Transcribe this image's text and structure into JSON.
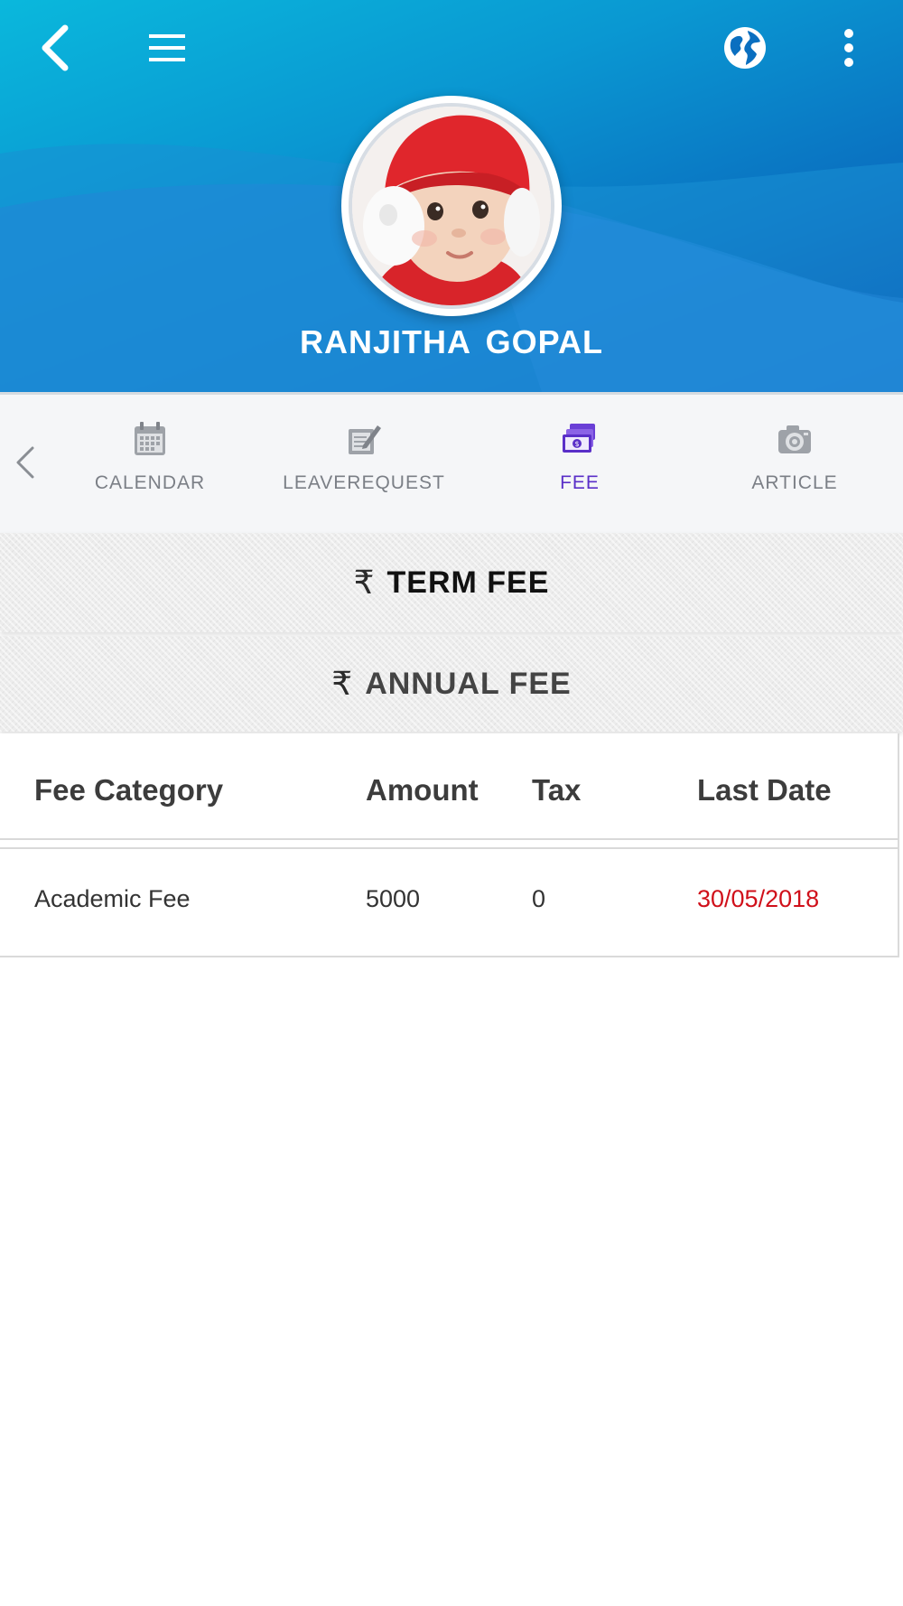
{
  "header": {
    "profile_name": "RANJITHA  GOPAL",
    "colors": {
      "gradient_start": "#0ab8dc",
      "gradient_end": "#063fa6"
    },
    "icons": [
      "back-arrow-icon",
      "hamburger-menu-icon",
      "globe-icon",
      "more-vertical-icon"
    ]
  },
  "tabs": {
    "items": [
      {
        "label": "CALENDAR",
        "icon": "calendar-icon",
        "active": false
      },
      {
        "label": "LEAVEREQUEST",
        "icon": "edit-note-icon",
        "active": false
      },
      {
        "label": "FEE",
        "icon": "cash-icon",
        "active": true
      },
      {
        "label": "ARTICLE",
        "icon": "camera-icon",
        "active": false
      }
    ],
    "active_color": "#5a2fc8"
  },
  "fee_sections": {
    "currency_symbol": "₹",
    "term_fee": "TERM FEE",
    "annual_fee": "ANNUAL FEE"
  },
  "fee_table": {
    "headers": [
      "Fee Category",
      "Amount",
      "Tax",
      "Last Date"
    ],
    "rows": [
      {
        "category": "Academic Fee",
        "amount": "5000",
        "tax": "0",
        "last_date": "30/05/2018"
      }
    ],
    "last_date_color": "#d0101a"
  }
}
